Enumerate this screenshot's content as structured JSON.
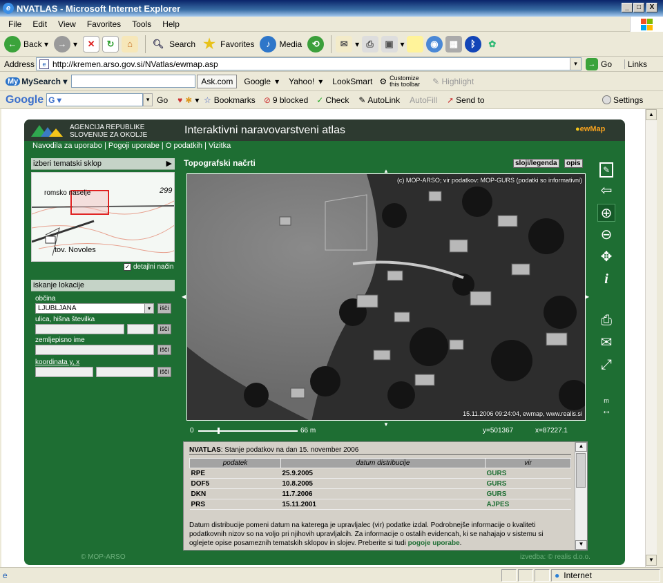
{
  "window": {
    "title": "NVATLAS - Microsoft Internet Explorer",
    "min": "_",
    "max": "□",
    "close": "X"
  },
  "menu": [
    "File",
    "Edit",
    "View",
    "Favorites",
    "Tools",
    "Help"
  ],
  "toolbar": {
    "back": "Back",
    "search": "Search",
    "favorites": "Favorites",
    "media": "Media"
  },
  "address": {
    "label": "Address",
    "url": "http://kremen.arso.gov.si/NVatlas/ewmap.asp",
    "go": "Go",
    "links": "Links"
  },
  "askbar": {
    "brand": "MySearch",
    "ask": "Ask.com",
    "google": "Google",
    "yahoo": "Yahoo!",
    "looksmart": "LookSmart",
    "customize": "Customize this toolbar",
    "highlight": "Highlight"
  },
  "googlebar": {
    "brand": "Google",
    "go": "Go",
    "bookmarks": "Bookmarks",
    "blocked": "9 blocked",
    "check": "Check",
    "autolink": "AutoLink",
    "autofill": "AutoFill",
    "sendto": "Send to",
    "settings": "Settings"
  },
  "app": {
    "agency_line1": "AGENCIJA REPUBLIKE",
    "agency_line2": "SLOVENIJE ZA OKOLJE",
    "title": "Interaktivni naravovarstveni atlas",
    "brand": "ewMap",
    "nav": "Navodila za uporabo | Pogoji uporabe | O podatkih | Vizitka",
    "theme_select": "izberi tematski sklop",
    "minimap_text1": "romsko naselje",
    "minimap_text2": "tov. Novoles",
    "minimap_num": "299",
    "detail_mode": "detajlni način",
    "search_title": "iskanje lokacije",
    "obcina_label": "občina",
    "obcina_value": "LJUBLJANA",
    "ulica_label": "ulica, hišna številka",
    "zemlj_label": "zemljepisno ime",
    "koord_label": "koordinata y, x",
    "isci": "išči",
    "map_title": "Topografski načrti",
    "btn_layers": "sloji/legenda",
    "btn_opis": "opis",
    "copyright": "(c) MOP-ARSO; vir podatkov: MOP-GURS (podatki so informativni)",
    "stamp": "15.11.2006 09:24:04, ewmap, www.realis.si",
    "scale_start": "0",
    "scale_end": "66 m",
    "coord_y": "y=501367",
    "coord_x": "x=87227.1",
    "info_title_prefix": "NVATLAS",
    "info_title": ": Stanje podatkov na dan 15. november 2006",
    "table_headers": [
      "podatek",
      "datum distribucije",
      "vir"
    ],
    "table_rows": [
      [
        "RPE",
        "25.9.2005",
        "GURS"
      ],
      [
        "DOF5",
        "10.8.2005",
        "GURS"
      ],
      [
        "DKN",
        "11.7.2006",
        "GURS"
      ],
      [
        "PRS",
        "15.11.2001",
        "AJPES"
      ]
    ],
    "info_text": "Datum distribucije pomeni datum na katerega je upravljalec (vir) podatke izdal. Podrobnejše informacije o kvaliteti podatkovnih nizov so na voljo pri njihovih upravljalcih. Za informacije o ostalih evidencah, ki se nahajajo v sistemu si oglejete opise posameznih tematskih sklopov in slojev. Preberite si tudi ",
    "info_link": "pogoje uporabe",
    "footer_left": "© MOP-ARSO",
    "footer_right": "izvedba: © realis d.o.o.",
    "measure": "m"
  },
  "status": {
    "zone": "Internet"
  }
}
